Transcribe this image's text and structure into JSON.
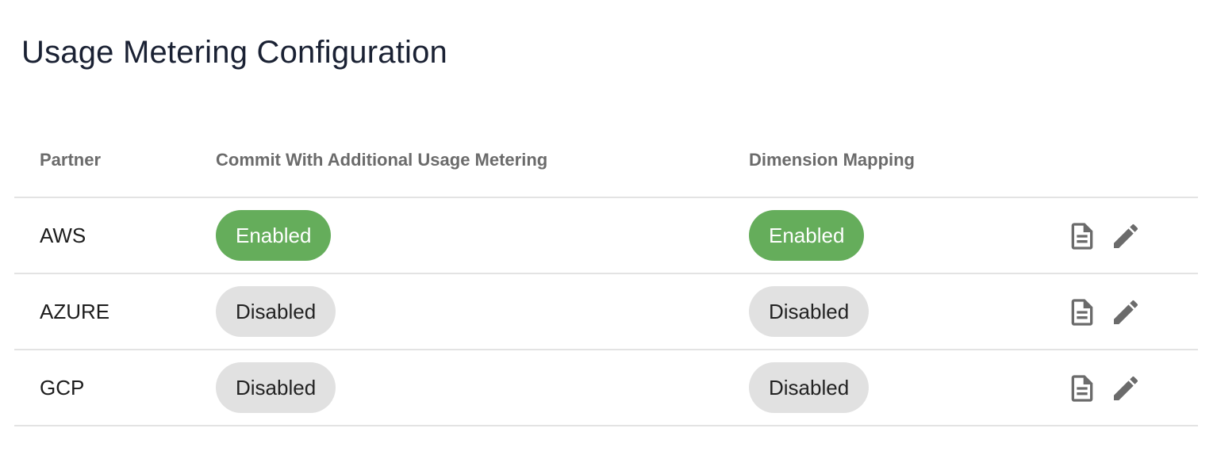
{
  "page": {
    "title": "Usage Metering Configuration"
  },
  "table": {
    "columns": {
      "partner": "Partner",
      "commit": "Commit With Additional Usage Metering",
      "dimension": "Dimension Mapping"
    },
    "rows": [
      {
        "partner": "AWS",
        "commit": "Enabled",
        "dimension": "Enabled"
      },
      {
        "partner": "AZURE",
        "commit": "Disabled",
        "dimension": "Disabled"
      },
      {
        "partner": "GCP",
        "commit": "Disabled",
        "dimension": "Disabled"
      }
    ],
    "row_actions": [
      "document-icon",
      "pencil-icon"
    ]
  },
  "colors": {
    "enabled": "#65ad5b",
    "disabled": "#e1e1e1",
    "icon": "#6b6b6b",
    "divider": "#e3e3e3"
  }
}
